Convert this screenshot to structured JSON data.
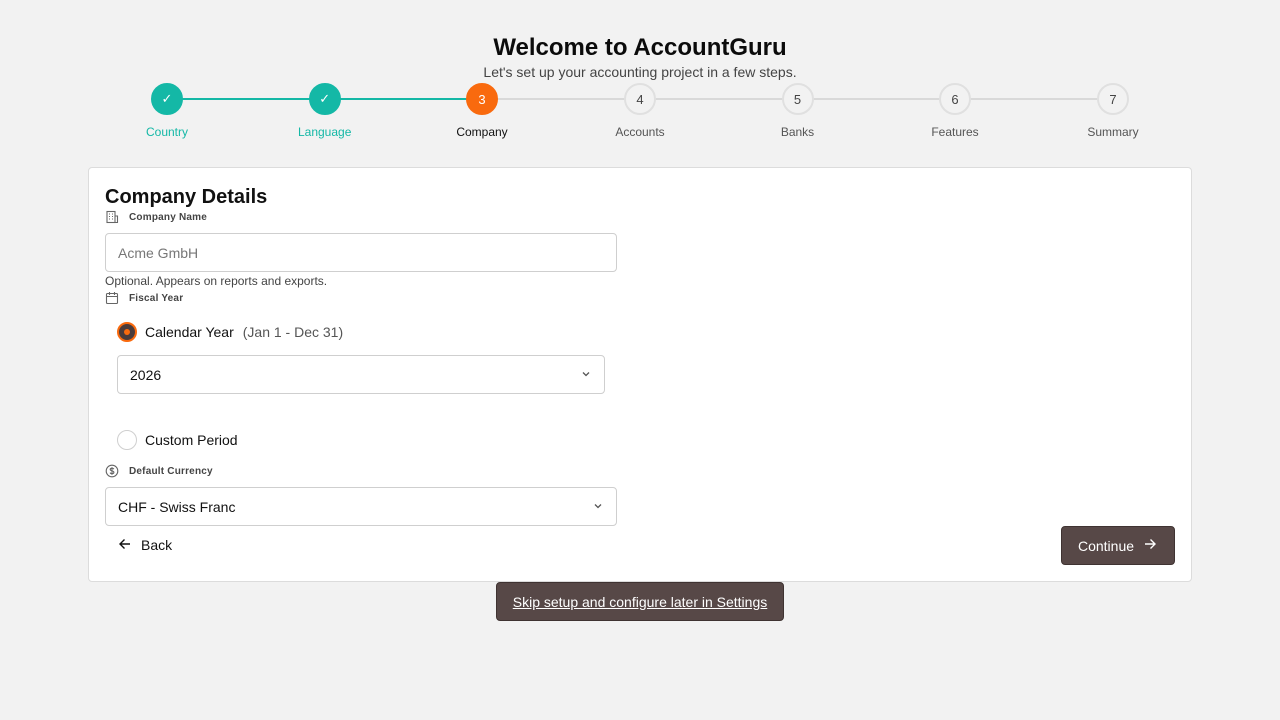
{
  "header": {
    "title": "Welcome to AccountGuru",
    "subtitle": "Let's set up your accounting project in a few steps."
  },
  "stepper": {
    "steps": [
      {
        "number": "1",
        "label": "Country",
        "state": "done",
        "mark": "✓"
      },
      {
        "number": "2",
        "label": "Language",
        "state": "done",
        "mark": "✓"
      },
      {
        "number": "3",
        "label": "Company",
        "state": "active",
        "mark": "3"
      },
      {
        "number": "4",
        "label": "Accounts",
        "state": "pending",
        "mark": "4"
      },
      {
        "number": "5",
        "label": "Banks",
        "state": "pending",
        "mark": "5"
      },
      {
        "number": "6",
        "label": "Features",
        "state": "pending",
        "mark": "6"
      },
      {
        "number": "7",
        "label": "Summary",
        "state": "pending",
        "mark": "7"
      }
    ]
  },
  "form": {
    "title": "Company Details",
    "company_name": {
      "label": "Company Name",
      "icon": "building-icon",
      "placeholder": "Acme GmbH",
      "value": "",
      "hint": "Optional. Appears on reports and exports."
    },
    "fiscal_year": {
      "label": "Fiscal Year",
      "icon": "calendar-icon",
      "option_calendar": {
        "label": "Calendar Year",
        "sub": "(Jan 1 - Dec 31)",
        "checked": true
      },
      "year_value": "2026",
      "option_custom": {
        "label": "Custom Period",
        "checked": false
      }
    },
    "currency": {
      "label": "Default Currency",
      "icon": "dollar-circle-icon",
      "value": "CHF - Swiss Franc"
    }
  },
  "actions": {
    "back_label": "Back",
    "continue_label": "Continue",
    "skip_label": "Skip setup and configure later in Settings"
  },
  "colors": {
    "accent": "#f96a0e",
    "done": "#14b8a6",
    "primary_button": "#574847",
    "background": "#f2f2f2"
  }
}
